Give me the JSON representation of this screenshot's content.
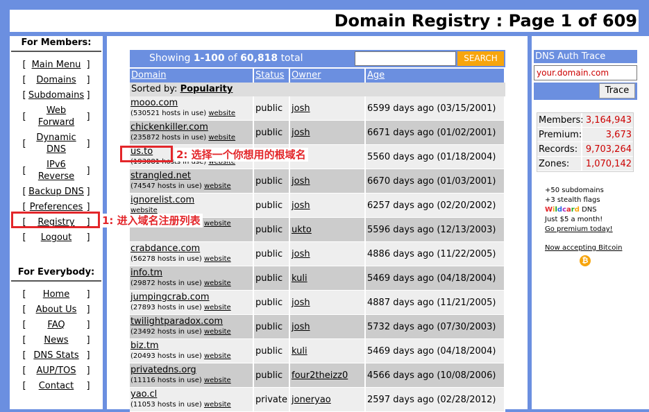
{
  "page": {
    "title": "Domain Registry : Page 1 of 609"
  },
  "left": {
    "members_heading": "For Members:",
    "members_items": [
      "Main Menu",
      "Domains",
      "Subdomains",
      "Web Forward",
      "Dynamic DNS",
      "IPv6 Reverse",
      "Backup DNS",
      "Preferences",
      "Registry",
      "Logout"
    ],
    "everybody_heading": "For Everybody:",
    "everybody_items": [
      "Home",
      "About Us",
      "FAQ",
      "News",
      "DNS Stats",
      "AUP/TOS",
      "Contact"
    ]
  },
  "search": {
    "showing_prefix": "Showing",
    "range": "1-100",
    "of_word": "of",
    "total_count": "60,818",
    "total_word": "total",
    "button": "SEARCH"
  },
  "table": {
    "headers": [
      "Domain",
      "Status",
      "Owner",
      "Age"
    ],
    "sorted_prefix": "Sorted by:",
    "sorted_value": "Popularity",
    "website_label": "website",
    "rows": [
      {
        "domain": "mooo.com",
        "hosts": "(530521 hosts in use)",
        "status": "public",
        "owner": "josh",
        "age": "6599 days ago (03/15/2001)"
      },
      {
        "domain": "chickenkiller.com",
        "hosts": "(235872 hosts in use)",
        "status": "public",
        "owner": "josh",
        "age": "6671 days ago (01/02/2001)"
      },
      {
        "domain": "us.to",
        "hosts": "(193081 hosts in use)",
        "status": "",
        "owner": "",
        "age": "5560 days ago (01/18/2004)"
      },
      {
        "domain": "strangled.net",
        "hosts": "(74547 hosts in use)",
        "status": "public",
        "owner": "josh",
        "age": "6670 days ago (01/03/2001)"
      },
      {
        "domain": "ignorelist.com",
        "hosts": "",
        "status": "public",
        "owner": "josh",
        "age": "6257 days ago (02/20/2002)"
      },
      {
        "domain": "",
        "hosts": "(61825 hosts in use)",
        "status": "public",
        "owner": "ukto",
        "age": "5596 days ago (12/13/2003)"
      },
      {
        "domain": "crabdance.com",
        "hosts": "(56278 hosts in use)",
        "status": "public",
        "owner": "josh",
        "age": "4886 days ago (11/22/2005)"
      },
      {
        "domain": "info.tm",
        "hosts": "(29872 hosts in use)",
        "status": "public",
        "owner": "kuli",
        "age": "5469 days ago (04/18/2004)"
      },
      {
        "domain": "jumpingcrab.com",
        "hosts": "(27893 hosts in use)",
        "status": "public",
        "owner": "josh",
        "age": "4887 days ago (11/21/2005)"
      },
      {
        "domain": "twilightparadox.com",
        "hosts": "(23492 hosts in use)",
        "status": "public",
        "owner": "josh",
        "age": "5732 days ago (07/30/2003)"
      },
      {
        "domain": "biz.tm",
        "hosts": "(20493 hosts in use)",
        "status": "public",
        "owner": "kuli",
        "age": "5469 days ago (04/18/2004)"
      },
      {
        "domain": "privatedns.org",
        "hosts": "(11116 hosts in use)",
        "status": "public",
        "owner": "four2theizz0",
        "age": "4566 days ago (10/08/2006)"
      },
      {
        "domain": "yao.cl",
        "hosts": "(11053 hosts in use)",
        "status": "private",
        "owner": "joneryao",
        "age": "2597 days ago (02/28/2012)"
      }
    ]
  },
  "right": {
    "trace_heading": "DNS Auth Trace",
    "trace_input_value": "your.domain.com",
    "trace_button": "Trace",
    "stats": [
      {
        "label": "Members:",
        "value": "3,164,943"
      },
      {
        "label": "Premium:",
        "value": "3,673"
      },
      {
        "label": "Records:",
        "value": "9,703,264"
      },
      {
        "label": "Zones:",
        "value": "1,070,142"
      }
    ],
    "promo_line1": "+50 subdomains",
    "promo_line2": "+3 stealth flags",
    "promo_wildcard": "Wildcard",
    "promo_dns": "DNS",
    "promo_line4": "Just $5 a month!",
    "promo_link": "Go premium today!",
    "bitcoin_text": "Now accepting Bitcoin",
    "bitcoin_symbol": "₿"
  },
  "annotations": {
    "step1": "1: 进入域名注册列表",
    "step2": "2: 选择一个你想用的根域名",
    "color": "#e3262a"
  }
}
